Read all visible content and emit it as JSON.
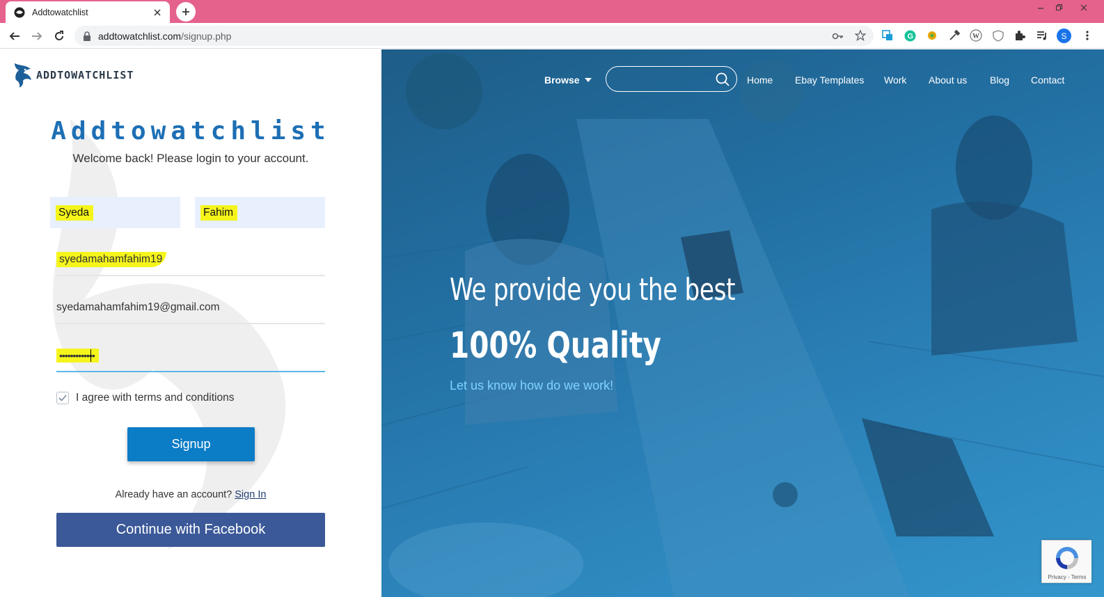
{
  "browser": {
    "tab_title": "Addtowatchlist",
    "url_domain": "addtowatchlist.com",
    "url_path": "/signup.php",
    "profile_initial": "S",
    "tab_color": "#e5628d"
  },
  "site": {
    "logo_text": "ADDTOWATCHLIST",
    "brand_heading": "Addtowatchlist",
    "welcome": "Welcome back! Please login to your account."
  },
  "form": {
    "first_name": "Syeda",
    "last_name": "Fahim",
    "username": "syedamahamfahim19",
    "email": "syedamahamfahim19@gmail.com",
    "password_masked": "•••••••••••••",
    "agree_label": "I agree with terms and conditions",
    "agree_checked": true,
    "signup_label": "Signup",
    "already_text": "Already have an account?",
    "signin_link": "Sign In",
    "facebook_label": "Continue with Facebook",
    "accent_color": "#0b7cc6",
    "facebook_color": "#3b5998",
    "highlight_color": "#f5f51c"
  },
  "nav": {
    "browse": "Browse",
    "search_placeholder": "",
    "links": [
      "Home",
      "Ebay Templates",
      "Work",
      "About us",
      "Blog",
      "Contact"
    ]
  },
  "hero": {
    "line1": "We provide you the best",
    "line2": "100% Quality",
    "line3": "Let us know how do we work!"
  },
  "recaptcha": {
    "links": "Privacy - Terms"
  }
}
